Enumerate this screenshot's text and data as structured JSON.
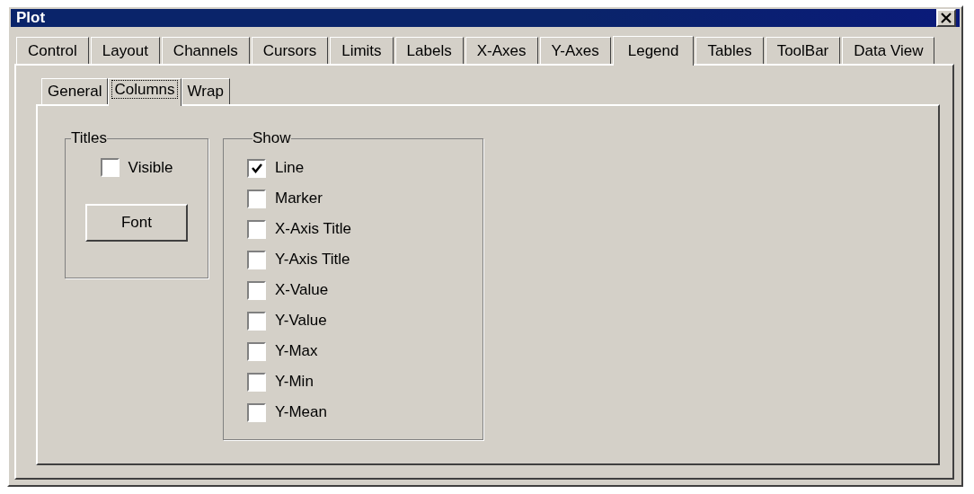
{
  "window": {
    "title": "Plot"
  },
  "tabs": [
    {
      "label": "Control",
      "selected": false
    },
    {
      "label": "Layout",
      "selected": false
    },
    {
      "label": "Channels",
      "selected": false
    },
    {
      "label": "Cursors",
      "selected": false
    },
    {
      "label": "Limits",
      "selected": false
    },
    {
      "label": "Labels",
      "selected": false
    },
    {
      "label": "X-Axes",
      "selected": false
    },
    {
      "label": "Y-Axes",
      "selected": false
    },
    {
      "label": "Legend",
      "selected": true
    },
    {
      "label": "Tables",
      "selected": false
    },
    {
      "label": "ToolBar",
      "selected": false
    },
    {
      "label": "Data View",
      "selected": false
    }
  ],
  "subtabs": [
    {
      "label": "General",
      "selected": false
    },
    {
      "label": "Columns",
      "selected": true
    },
    {
      "label": "Wrap",
      "selected": false
    }
  ],
  "titles_group": {
    "title": "Titles",
    "visible": {
      "label": "Visible",
      "checked": false
    },
    "font_button": "Font"
  },
  "show_group": {
    "title": "Show",
    "items": [
      {
        "label": "Line",
        "checked": true
      },
      {
        "label": "Marker",
        "checked": false
      },
      {
        "label": "X-Axis Title",
        "checked": false
      },
      {
        "label": "Y-Axis Title",
        "checked": false
      },
      {
        "label": "X-Value",
        "checked": false
      },
      {
        "label": "Y-Value",
        "checked": false
      },
      {
        "label": "Y-Max",
        "checked": false
      },
      {
        "label": "Y-Min",
        "checked": false
      },
      {
        "label": "Y-Mean",
        "checked": false
      }
    ]
  }
}
